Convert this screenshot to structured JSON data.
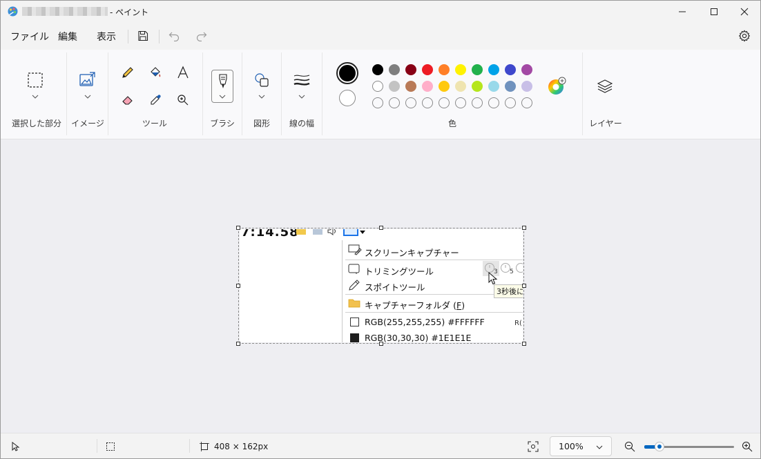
{
  "window": {
    "title": "- ペイント"
  },
  "menu": {
    "file": "ファイル",
    "edit": "編集",
    "view": "表示"
  },
  "ribbon": {
    "groups": {
      "selection": "選択した部分",
      "image": "イメージ",
      "tools": "ツール",
      "brush": "ブラシ",
      "shapes": "図形",
      "stroke": "線の幅",
      "colors": "色",
      "layers": "レイヤー"
    },
    "primary_color": "#000000",
    "secondary_color": "#ffffff",
    "palette_row1": [
      "#000000",
      "#7f7f7f",
      "#880015",
      "#ed1c24",
      "#ff7f27",
      "#fff200",
      "#22b14c",
      "#00a2e8",
      "#3f48cc",
      "#a349a4"
    ],
    "palette_row2": [
      "#ffffff",
      "#c3c3c3",
      "#b97a57",
      "#ffaec9",
      "#ffc90e",
      "#efe4b0",
      "#b5e61d",
      "#99d9ea",
      "#7092be",
      "#c8bfe7"
    ]
  },
  "canvas_content": {
    "time": "7:14.58",
    "items": {
      "screen_capture": "スクリーンキャプチャー",
      "trimming": "トリミングツール",
      "eyedropper": "スポイトツール",
      "capture_folder": "キャプチャーフォルダ (",
      "capture_folder_key": "F",
      "capture_folder_end": ")",
      "rgb_white": "RGB(255,255,255) #FFFFFF",
      "rgb_dark": "RGB(30,30,30) #1E1E1E"
    },
    "timer_3": "3",
    "timer_5": "5",
    "tooltip": "3秒後に",
    "side_label": "R("
  },
  "status": {
    "canvas_size": "408 × 162px",
    "zoom": "100%",
    "zoom_level": 0.17
  }
}
